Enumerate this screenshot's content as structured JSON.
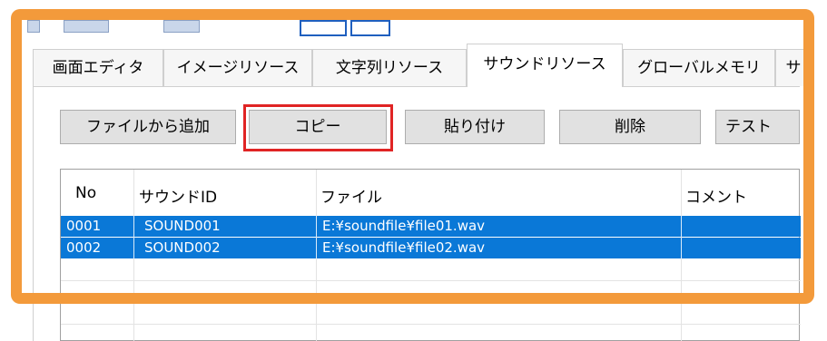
{
  "tabs": [
    {
      "label": "画面エディタ"
    },
    {
      "label": "イメージリソース"
    },
    {
      "label": "文字列リソース"
    },
    {
      "label": "サウンドリソース",
      "active": true
    },
    {
      "label": "グローバルメモリ"
    },
    {
      "label": "サ"
    }
  ],
  "toolbar": {
    "add_from_file_label": "ファイルから追加",
    "copy_label": "コピー",
    "paste_label": "貼り付け",
    "delete_label": "削除",
    "test_label": "テスト"
  },
  "table": {
    "headers": {
      "no": "No",
      "sound_id": "サウンドID",
      "file": "ファイル",
      "comment": "コメント"
    },
    "rows": [
      {
        "no": "0001",
        "sound_id": "SOUND001",
        "file": "E:¥soundfile¥file01.wav",
        "comment": "",
        "selected": true
      },
      {
        "no": "0002",
        "sound_id": "SOUND002",
        "file": "E:¥soundfile¥file02.wav",
        "comment": "",
        "selected": true
      }
    ]
  },
  "colors": {
    "highlight_frame": "#f39a3b",
    "copy_button_highlight": "#e02424",
    "selection": "#0a78d7"
  }
}
